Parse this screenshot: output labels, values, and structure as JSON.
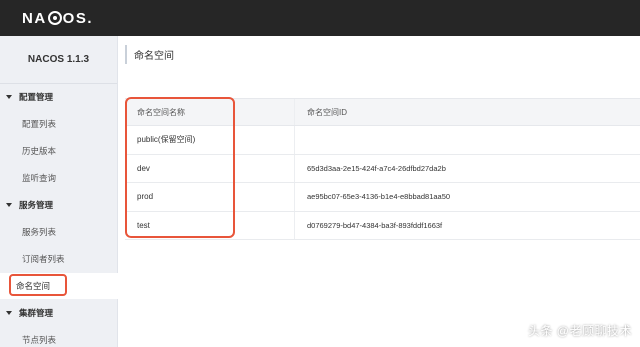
{
  "header": {
    "logo_text_left": "NA",
    "logo_text_right": "OS."
  },
  "sidebar": {
    "title": "NACOS 1.1.3",
    "groups": [
      {
        "label": "配置管理",
        "items": [
          "配置列表",
          "历史版本",
          "监听查询"
        ]
      },
      {
        "label": "服务管理",
        "items": [
          "服务列表",
          "订阅者列表",
          "命名空间"
        ]
      },
      {
        "label": "集群管理",
        "items": [
          "节点列表"
        ]
      }
    ],
    "active_item": "命名空间"
  },
  "main": {
    "title": "命名空间",
    "table": {
      "columns": [
        "命名空间名称",
        "命名空间ID"
      ],
      "rows": [
        [
          "public(保留空间)",
          ""
        ],
        [
          "dev",
          "65d3d3aa-2e15-424f-a7c4-26dfbd27da2b"
        ],
        [
          "prod",
          "ae95bc07-65e3-4136-b1e4-e8bbad81aa50"
        ],
        [
          "test",
          "d0769279-bd47-4384-ba3f-893fddf1663f"
        ]
      ]
    }
  },
  "watermark": "头条 @老顾聊技术",
  "colors": {
    "topbar": "#262626",
    "sidebar_bg": "#eef0f4",
    "highlight": "#e8553a"
  }
}
